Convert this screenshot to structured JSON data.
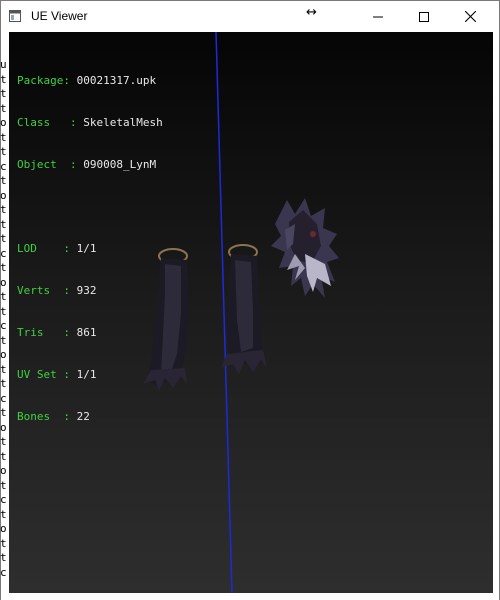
{
  "window": {
    "title": "UE Viewer",
    "resize_glyph": "↔"
  },
  "info": {
    "package_label": "Package",
    "package_value": "00021317.upk",
    "class_label": "Class",
    "class_value": "SkeletalMesh",
    "object_label": "Object",
    "object_value": "090008_LynM",
    "lod_label": "LOD",
    "lod_value": "1/1",
    "verts_label": "Verts",
    "verts_value": "932",
    "tris_label": "Tris",
    "tris_value": "861",
    "uvset_label": "UV Set",
    "uvset_value": "1/1",
    "bones_label": "Bones",
    "bones_value": "22"
  },
  "background_window": {
    "left_glyphs": [
      "u",
      "t",
      "t",
      "t",
      "o",
      "t",
      "t",
      "c",
      "t",
      "o",
      "t",
      "t",
      "t",
      "c",
      "t",
      "o",
      "t",
      "t",
      "c",
      "t",
      "o",
      "t",
      "t",
      "c",
      "t",
      "o",
      "t",
      "t",
      "o",
      "t",
      "c",
      "t",
      "o",
      "t",
      "t",
      "c"
    ]
  },
  "colors": {
    "label_green": "#3fd13f",
    "axis_blue": "#1d2bd6",
    "value_text": "#e8e8e8"
  },
  "icons": {
    "app": "window-icon",
    "minimize": "minimize-icon",
    "maximize": "maximize-icon",
    "close": "close-icon",
    "resize": "resize-cursor-icon"
  }
}
